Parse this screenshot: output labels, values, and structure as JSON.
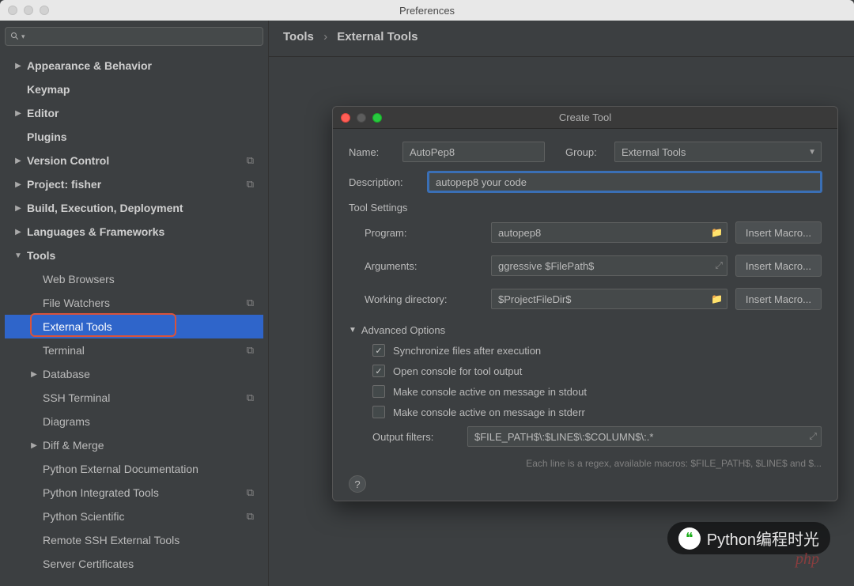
{
  "window": {
    "title": "Preferences"
  },
  "search": {
    "placeholder": ""
  },
  "sidebar": {
    "items": [
      {
        "label": "Appearance & Behavior",
        "arrow": "▶",
        "bold": true,
        "indent": 0
      },
      {
        "label": "Keymap",
        "arrow": "",
        "bold": true,
        "indent": 0
      },
      {
        "label": "Editor",
        "arrow": "▶",
        "bold": true,
        "indent": 0
      },
      {
        "label": "Plugins",
        "arrow": "",
        "bold": true,
        "indent": 0
      },
      {
        "label": "Version Control",
        "arrow": "▶",
        "bold": true,
        "indent": 0,
        "dup": true
      },
      {
        "label": "Project: fisher",
        "arrow": "▶",
        "bold": true,
        "indent": 0,
        "dup": true
      },
      {
        "label": "Build, Execution, Deployment",
        "arrow": "▶",
        "bold": true,
        "indent": 0
      },
      {
        "label": "Languages & Frameworks",
        "arrow": "▶",
        "bold": true,
        "indent": 0
      },
      {
        "label": "Tools",
        "arrow": "▼",
        "bold": true,
        "indent": 0
      },
      {
        "label": "Web Browsers",
        "arrow": "",
        "bold": false,
        "indent": 1
      },
      {
        "label": "File Watchers",
        "arrow": "",
        "bold": false,
        "indent": 1,
        "dup": true
      },
      {
        "label": "External Tools",
        "arrow": "",
        "bold": false,
        "indent": 1,
        "selected": true
      },
      {
        "label": "Terminal",
        "arrow": "",
        "bold": false,
        "indent": 1,
        "dup": true
      },
      {
        "label": "Database",
        "arrow": "▶",
        "bold": false,
        "indent": 1
      },
      {
        "label": "SSH Terminal",
        "arrow": "",
        "bold": false,
        "indent": 1,
        "dup": true
      },
      {
        "label": "Diagrams",
        "arrow": "",
        "bold": false,
        "indent": 1
      },
      {
        "label": "Diff & Merge",
        "arrow": "▶",
        "bold": false,
        "indent": 1
      },
      {
        "label": "Python External Documentation",
        "arrow": "",
        "bold": false,
        "indent": 1
      },
      {
        "label": "Python Integrated Tools",
        "arrow": "",
        "bold": false,
        "indent": 1,
        "dup": true
      },
      {
        "label": "Python Scientific",
        "arrow": "",
        "bold": false,
        "indent": 1,
        "dup": true
      },
      {
        "label": "Remote SSH External Tools",
        "arrow": "",
        "bold": false,
        "indent": 1
      },
      {
        "label": "Server Certificates",
        "arrow": "",
        "bold": false,
        "indent": 1
      }
    ]
  },
  "breadcrumb": {
    "a": "Tools",
    "sep": "›",
    "b": "External Tools"
  },
  "dialog": {
    "title": "Create Tool",
    "name_label": "Name:",
    "name_value": "AutoPep8",
    "group_label": "Group:",
    "group_value": "External Tools",
    "description_label": "Description:",
    "description_value": "autopep8 your code",
    "tool_settings_label": "Tool Settings",
    "program_label": "Program:",
    "program_value": "autopep8",
    "arguments_label": "Arguments:",
    "arguments_value": "ggressive $FilePath$",
    "workdir_label": "Working directory:",
    "workdir_value": "$ProjectFileDir$",
    "insert_macro": "Insert Macro...",
    "advanced_label": "Advanced Options",
    "checks": [
      {
        "label": "Synchronize files after execution",
        "on": true
      },
      {
        "label": "Open console for tool output",
        "on": true
      },
      {
        "label": "Make console active on message in stdout",
        "on": false
      },
      {
        "label": "Make console active on message in stderr",
        "on": false
      }
    ],
    "output_filters_label": "Output filters:",
    "output_filters_value": "$FILE_PATH$\\:$LINE$\\:$COLUMN$\\:.*",
    "hint": "Each line is a regex, available macros: $FILE_PATH$, $LINE$ and $...",
    "help": "?"
  },
  "watermark": {
    "text": "Python编程时光"
  },
  "php_mark": "php"
}
